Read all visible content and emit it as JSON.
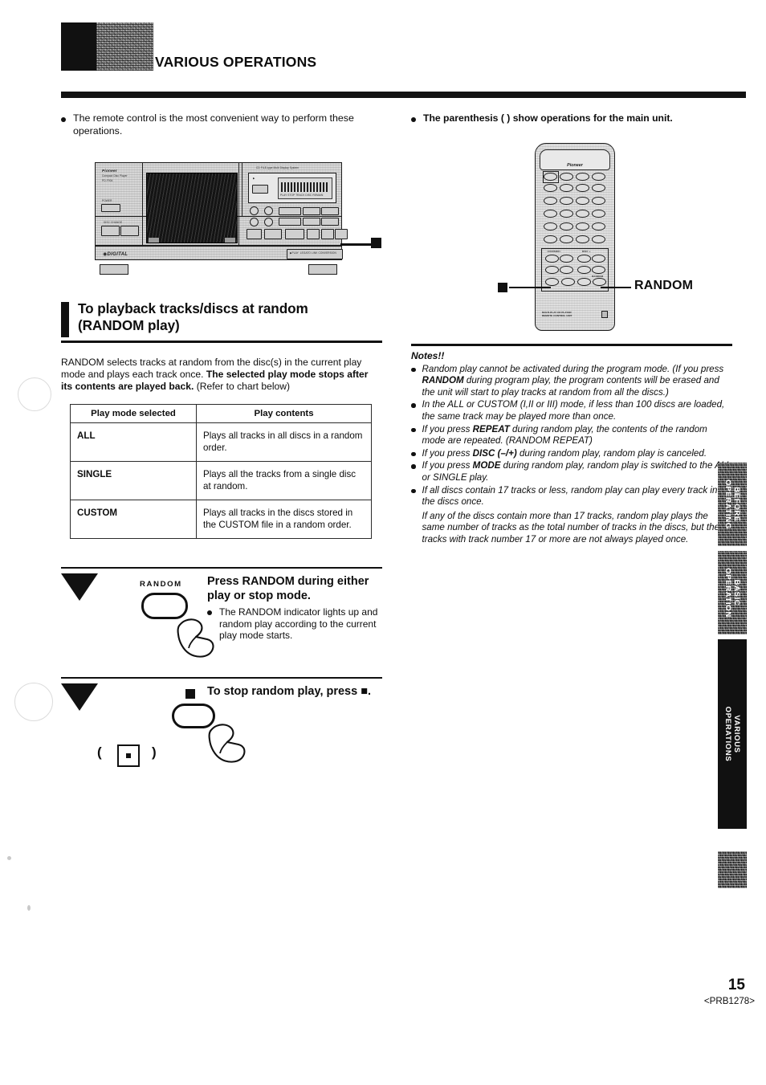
{
  "header": {
    "title": "VARIOUS OPERATIONS"
  },
  "intro_bullets": {
    "left": "The remote control is the most convenient way to perform these operations.",
    "right": "The parenthesis (  ) show operations for the main unit."
  },
  "illustrations": {
    "main_unit": {
      "brand": "Pioneer",
      "model": "PD-F904",
      "display_caption": "CD FILE-type Multi Display System",
      "legend_stop": "■"
    },
    "remote": {
      "brand": "Pioneer",
      "footer_text": "MULTI-PLAY CD PLAYER\nREMOTE CONTROL UNIT",
      "callout_random": "RANDOM",
      "callout_stop": "■"
    }
  },
  "section": {
    "heading_line1": "To playback tracks/discs at random",
    "heading_line2": "(RANDOM play)",
    "intro_part1": "RANDOM selects tracks at random from the disc(s) in the current play mode and plays each track once. ",
    "intro_bold": "The selected play mode stops after its contents are played back.",
    "intro_part2": " (Refer to chart below)"
  },
  "table": {
    "headers": [
      "Play mode selected",
      "Play contents"
    ],
    "rows": [
      {
        "mode": "ALL",
        "contents": "Plays all tracks in all discs in a random order."
      },
      {
        "mode": "SINGLE",
        "contents": "Plays all the tracks from a single disc at random."
      },
      {
        "mode": "CUSTOM",
        "contents": "Plays all tracks in the discs stored in the CUSTOM file in a random order."
      }
    ]
  },
  "steps": [
    {
      "key_label": "RANDOM",
      "title": "Press RANDOM during either play or stop mode.",
      "sub": "The RANDOM indicator lights up and random play according to the current play mode starts.",
      "main_unit_key": ""
    },
    {
      "key_label": "■",
      "title": "To stop random play, press ■.",
      "sub": "",
      "paren_open": "(",
      "paren_close": ")"
    }
  ],
  "notes": {
    "title": "Notes!!",
    "items": [
      {
        "segments": [
          {
            "t": "Random play cannot be activated during the program mode. (If you press ",
            "b": false
          },
          {
            "t": "RANDOM",
            "b": true
          },
          {
            "t": " during program play, the program contents will be erased and the unit will start to play tracks at random from all the discs.)",
            "b": false
          }
        ]
      },
      {
        "segments": [
          {
            "t": "In the ALL or CUSTOM (I,II or III) mode, if less than 100 discs are loaded, the same track may be played more than once.",
            "b": false
          }
        ]
      },
      {
        "segments": [
          {
            "t": "If you press ",
            "b": false
          },
          {
            "t": "REPEAT",
            "b": true
          },
          {
            "t": " during random play, the contents of the random mode are repeated. (RANDOM REPEAT)",
            "b": false
          }
        ]
      },
      {
        "segments": [
          {
            "t": "If you press ",
            "b": false
          },
          {
            "t": "DISC (–/+)",
            "b": true
          },
          {
            "t": " during random play, random play is canceled.",
            "b": false
          }
        ]
      },
      {
        "segments": [
          {
            "t": "If you press ",
            "b": false
          },
          {
            "t": "MODE",
            "b": true
          },
          {
            "t": " during random play, random play is switched to the ALL or SINGLE play.",
            "b": false
          }
        ]
      },
      {
        "segments": [
          {
            "t": "If all discs contain 17 tracks or less, random play can play every track in the discs once.",
            "b": false
          }
        ],
        "extra": "If any of the discs contain more than 17 tracks, random play plays the same number of tracks as the total number of tracks in the discs, but the tracks with track number 17 or more are not always played once."
      }
    ]
  },
  "side_tabs": [
    {
      "label": "BEFORE\nOPERATING",
      "active": false
    },
    {
      "label": "BASIC\nOPERATION",
      "active": false
    },
    {
      "label": "VARIOUS\nOPERATIONS",
      "active": true
    },
    {
      "label": "",
      "active": false
    }
  ],
  "footer": {
    "page_number": "15",
    "doc_code": "<PRB1278>"
  },
  "colors": {
    "ink": "#111111",
    "paper": "#ffffff",
    "panel": "#dcdcdc"
  }
}
